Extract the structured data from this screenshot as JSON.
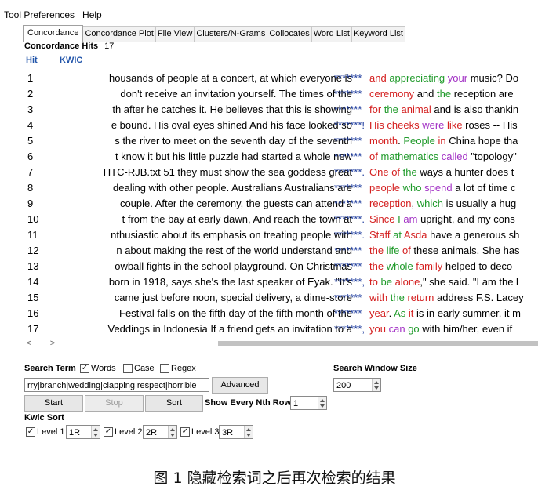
{
  "menu": [
    "Tool Preferences",
    "Help"
  ],
  "tabs": [
    "Concordance",
    "Concordance Plot",
    "File View",
    "Clusters/N-Grams",
    "Collocates",
    "Word List",
    "Keyword List"
  ],
  "hits": {
    "label": "Concordance Hits",
    "count": "17"
  },
  "columns": {
    "hit": "Hit",
    "kwic": "KWIC"
  },
  "stars": [
    "*******",
    "*******",
    "*******",
    "*******!",
    "*******",
    "*******",
    "*******.",
    "*******",
    "*******",
    "*******.",
    "*******.",
    "*******",
    "*******",
    "*******,",
    "*******",
    "*******",
    "*******,"
  ],
  "rows": [
    {
      "n": "1",
      "left": "housands of people at a concert, at which everyone is"
    },
    {
      "n": "2",
      "left": "don't receive an invitation yourself.  The times of the"
    },
    {
      "n": "3",
      "left": "th after he catches it. He believes that this is showing"
    },
    {
      "n": "4",
      "left": "e bound.  His oval eyes shined And his face looked so"
    },
    {
      "n": "5",
      "left": "s the river to meet on the seventh day of the seventh"
    },
    {
      "n": "6",
      "left": "t know it but his little puzzle had started a whole new"
    },
    {
      "n": "7",
      "left": "HTC-RJB.txt 51   they must show the sea goddess great"
    },
    {
      "n": "8",
      "left": "dealing with other people. Australians Australians are"
    },
    {
      "n": "9",
      "left": "couple.  After the ceremony, the guests can attend a"
    },
    {
      "n": "10",
      "left": "t from the bay at early dawn,  And reach the town at"
    },
    {
      "n": "11",
      "left": "nthusiastic about its emphasis on treating people with"
    },
    {
      "n": "12",
      "left": "n about making the rest of the world understand and"
    },
    {
      "n": "13",
      "left": "owball fights in the school playground.  On Christmas"
    },
    {
      "n": "14",
      "left": "born in 1918, says she's the last speaker of Eyak. \"It's"
    },
    {
      "n": "15",
      "left": "came just before noon, special delivery, a dime-store"
    },
    {
      "n": "16",
      "left": "Festival falls on the fifth day of the fifth month of the"
    },
    {
      "n": "17",
      "left": "Veddings in Indonesia If a friend gets an invitation to a"
    }
  ],
  "right_segments": [
    [
      [
        "and",
        "red"
      ],
      [
        " ",
        "black"
      ],
      [
        "appreciating",
        "green"
      ],
      [
        " ",
        "black"
      ],
      [
        "your",
        "purple"
      ],
      [
        " music? Do",
        "black"
      ]
    ],
    [
      [
        "ceremony",
        "red"
      ],
      [
        " and ",
        "black"
      ],
      [
        "the",
        "green"
      ],
      [
        " reception are",
        "black"
      ]
    ],
    [
      [
        "for",
        "red"
      ],
      [
        " ",
        "black"
      ],
      [
        "the",
        "green"
      ],
      [
        " ",
        "black"
      ],
      [
        "animal",
        "red"
      ],
      [
        " and is also thankin",
        "black"
      ]
    ],
    [
      [
        "His",
        "red"
      ],
      [
        " ",
        "black"
      ],
      [
        "cheeks",
        "red"
      ],
      [
        " ",
        "black"
      ],
      [
        "were",
        "purple"
      ],
      [
        " ",
        "black"
      ],
      [
        "like",
        "red"
      ],
      [
        " roses -- His",
        "black"
      ]
    ],
    [
      [
        "month",
        "red"
      ],
      [
        ". ",
        "black"
      ],
      [
        "People",
        "green"
      ],
      [
        " ",
        "black"
      ],
      [
        "in",
        "red"
      ],
      [
        " China hope tha",
        "black"
      ]
    ],
    [
      [
        "of",
        "red"
      ],
      [
        " ",
        "black"
      ],
      [
        "mathematics",
        "green"
      ],
      [
        " ",
        "black"
      ],
      [
        "called",
        "purple"
      ],
      [
        " \"topology\"",
        "black"
      ]
    ],
    [
      [
        "One",
        "red"
      ],
      [
        " ",
        "black"
      ],
      [
        "of",
        "red"
      ],
      [
        " ",
        "black"
      ],
      [
        "the",
        "green"
      ],
      [
        " ways a hunter does t",
        "black"
      ]
    ],
    [
      [
        "people",
        "red"
      ],
      [
        " ",
        "black"
      ],
      [
        "who",
        "green"
      ],
      [
        " ",
        "black"
      ],
      [
        "spend",
        "purple"
      ],
      [
        " a lot of time c",
        "black"
      ]
    ],
    [
      [
        "reception",
        "red"
      ],
      [
        ", ",
        "black"
      ],
      [
        "which",
        "green"
      ],
      [
        " is usually a hug",
        "black"
      ]
    ],
    [
      [
        "Since",
        "red"
      ],
      [
        " ",
        "black"
      ],
      [
        "I",
        "green"
      ],
      [
        " ",
        "black"
      ],
      [
        "am",
        "purple"
      ],
      [
        " upright, and my cons",
        "black"
      ]
    ],
    [
      [
        "Staff",
        "red"
      ],
      [
        " ",
        "black"
      ],
      [
        "at",
        "green"
      ],
      [
        " ",
        "black"
      ],
      [
        "Asda",
        "red"
      ],
      [
        " have a generous sh",
        "black"
      ]
    ],
    [
      [
        "the",
        "red"
      ],
      [
        " ",
        "black"
      ],
      [
        "life",
        "green"
      ],
      [
        " ",
        "black"
      ],
      [
        "of",
        "red"
      ],
      [
        " these animals. She has",
        "black"
      ]
    ],
    [
      [
        "the",
        "red"
      ],
      [
        " ",
        "black"
      ],
      [
        "whole",
        "green"
      ],
      [
        " ",
        "black"
      ],
      [
        "family",
        "red"
      ],
      [
        " helped to deco",
        "black"
      ]
    ],
    [
      [
        "to",
        "red"
      ],
      [
        " ",
        "black"
      ],
      [
        "be",
        "green"
      ],
      [
        " ",
        "black"
      ],
      [
        "alone",
        "red"
      ],
      [
        ",\" she said. \"I am the l",
        "black"
      ]
    ],
    [
      [
        "with",
        "red"
      ],
      [
        " ",
        "black"
      ],
      [
        "the",
        "green"
      ],
      [
        " ",
        "black"
      ],
      [
        "return",
        "red"
      ],
      [
        " address F.S. Lacey",
        "black"
      ]
    ],
    [
      [
        "year",
        "red"
      ],
      [
        ". ",
        "black"
      ],
      [
        "As",
        "green"
      ],
      [
        " ",
        "black"
      ],
      [
        "it",
        "red"
      ],
      [
        " is in early summer, it m",
        "black"
      ]
    ],
    [
      [
        "you",
        "red"
      ],
      [
        " ",
        "black"
      ],
      [
        "can",
        "purple"
      ],
      [
        " ",
        "black"
      ],
      [
        "go",
        "green"
      ],
      [
        " with him/her, even if",
        "black"
      ]
    ]
  ],
  "search": {
    "label": "Search Term",
    "words_label": "Words",
    "case_label": "Case",
    "regex_label": "Regex",
    "term_value": "rry|branch|wedding|clapping|respect|horrible",
    "advanced_label": "Advanced",
    "window_label": "Search Window Size",
    "window_value": "200"
  },
  "buttons": {
    "start": "Start",
    "stop": "Stop",
    "sort": "Sort"
  },
  "nth": {
    "label": "Show Every Nth Row",
    "value": "1"
  },
  "kwic_sort": {
    "label": "Kwic Sort",
    "levels": [
      {
        "label": "Level 1",
        "value": "1R"
      },
      {
        "label": "Level 2",
        "value": "2R"
      },
      {
        "label": "Level 3",
        "value": "3R"
      }
    ]
  },
  "nav": {
    "left": "<",
    "right": ">"
  },
  "caption": "图 1    隐藏检索词之后再次检索的结果",
  "colors": {
    "red": "#d42020",
    "green": "#1f9a2a",
    "purple": "#a12fc4",
    "stars": "#1e3c9e",
    "header": "#2255aa"
  }
}
